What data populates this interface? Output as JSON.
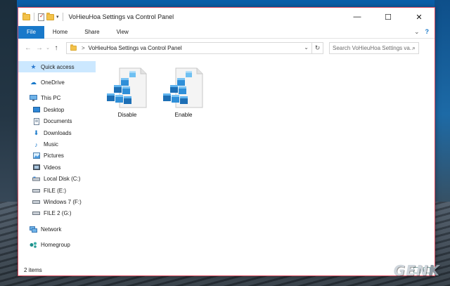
{
  "window": {
    "title": "VoHieuHoa Settings va Control Panel",
    "controls": {
      "minimize": "—",
      "maximize": "☐",
      "close": "✕"
    }
  },
  "ribbon": {
    "tabs": [
      "File",
      "Home",
      "Share",
      "View"
    ],
    "expand_glyph": "⌄",
    "help_glyph": "?"
  },
  "address": {
    "path": "VoHieuHoa Settings va Control Panel",
    "separator": ">",
    "search_placeholder": "Search VoHieuHoa Settings va..."
  },
  "sidebar": {
    "items": [
      {
        "label": "Quick access",
        "icon": "star-icon",
        "selected": true
      },
      {
        "label": "OneDrive",
        "icon": "cloud-icon"
      },
      {
        "label": "This PC",
        "icon": "monitor-icon"
      },
      {
        "label": "Desktop",
        "icon": "desktop-icon"
      },
      {
        "label": "Documents",
        "icon": "document-icon"
      },
      {
        "label": "Downloads",
        "icon": "download-icon"
      },
      {
        "label": "Music",
        "icon": "music-icon"
      },
      {
        "label": "Pictures",
        "icon": "pictures-icon"
      },
      {
        "label": "Videos",
        "icon": "video-icon"
      },
      {
        "label": "Local Disk (C:)",
        "icon": "drive-icon"
      },
      {
        "label": "FILE (E:)",
        "icon": "drive-icon"
      },
      {
        "label": "Windows 7 (F:)",
        "icon": "drive-icon"
      },
      {
        "label": "FILE 2 (G:)",
        "icon": "drive-icon"
      },
      {
        "label": "Network",
        "icon": "network-icon"
      },
      {
        "label": "Homegroup",
        "icon": "homegroup-icon"
      }
    ]
  },
  "files": [
    {
      "name": "Disable",
      "icon": "registry-file-icon"
    },
    {
      "name": "Enable",
      "icon": "registry-file-icon"
    }
  ],
  "status": {
    "count": "2 items"
  },
  "watermark": {
    "text": "GEN",
    "accent": "K"
  },
  "colors": {
    "accent": "#1979ca",
    "window_border": "#d6475a",
    "selected": "#cce8ff"
  }
}
